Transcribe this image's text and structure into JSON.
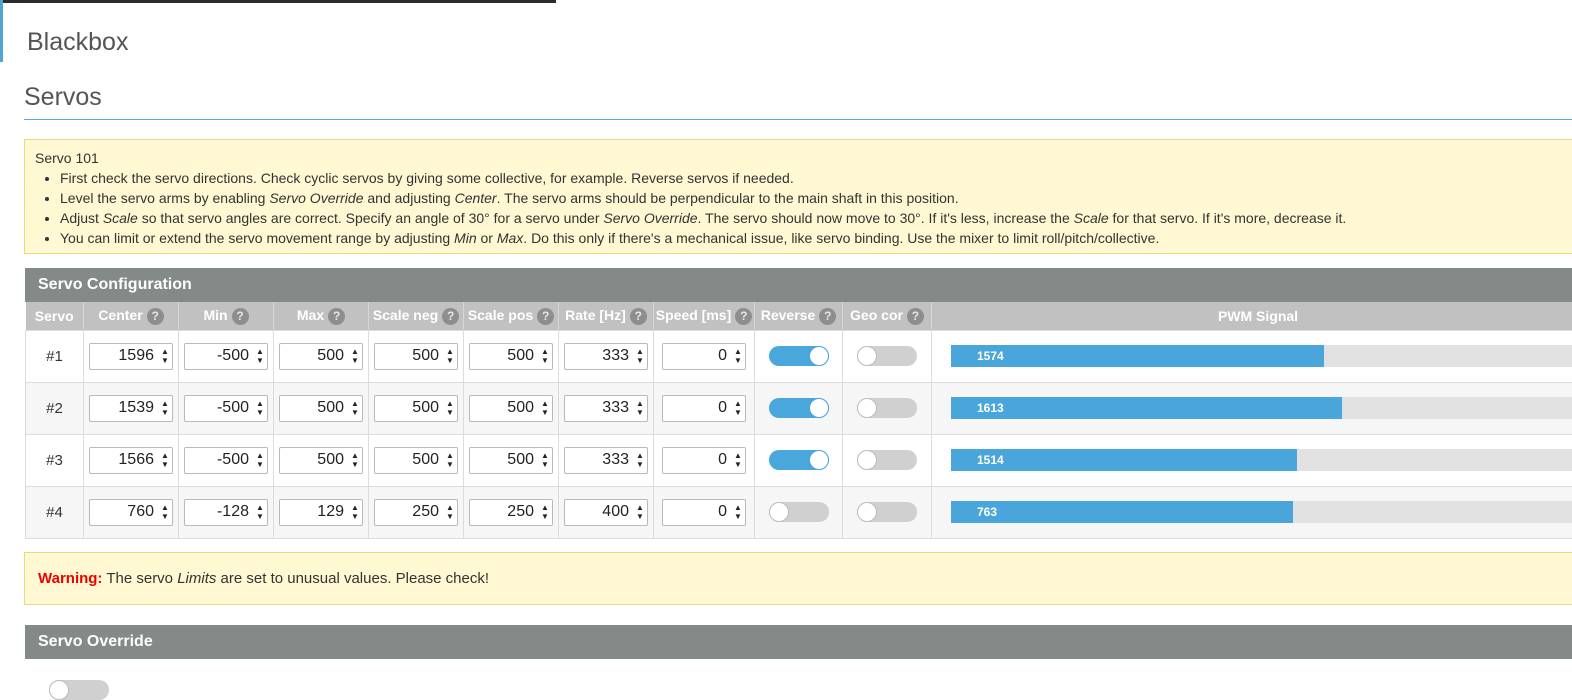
{
  "app": {
    "title": "Blackbox"
  },
  "page": {
    "title": "Servos"
  },
  "note": {
    "title": "Servo 101",
    "items": [
      [
        "First check the servo directions. Check cyclic servos by giving some collective, for example. Reverse servos if needed."
      ],
      [
        "Level the servo arms by enabling ",
        {
          "em": "Servo Override"
        },
        " and adjusting ",
        {
          "em": "Center"
        },
        ". The servo arms should be perpendicular to the main shaft in this position."
      ],
      [
        "Adjust ",
        {
          "em": "Scale"
        },
        " so that servo angles are correct. Specify an angle of 30° for a servo under ",
        {
          "em": "Servo Override"
        },
        ". The servo should now move to 30°. If it's less, increase the ",
        {
          "em": "Scale"
        },
        " for that servo. If it's more, decrease it."
      ],
      [
        "You can limit or extend the servo movement range by adjusting ",
        {
          "em": "Min"
        },
        " or ",
        {
          "em": "Max"
        },
        ". Do this only if there's a mechanical issue, like servo binding. Use the mixer to limit roll/pitch/collective."
      ]
    ]
  },
  "config": {
    "title": "Servo Configuration",
    "columns": [
      {
        "label": "Servo",
        "help": false
      },
      {
        "label": "Center",
        "help": true
      },
      {
        "label": "Min",
        "help": true
      },
      {
        "label": "Max",
        "help": true
      },
      {
        "label": "Scale neg",
        "help": true
      },
      {
        "label": "Scale pos",
        "help": true
      },
      {
        "label": "Rate [Hz]",
        "help": true
      },
      {
        "label": "Speed [ms]",
        "help": true
      },
      {
        "label": "Reverse",
        "help": true
      },
      {
        "label": "Geo cor",
        "help": true
      },
      {
        "label": "PWM Signal",
        "help": false
      }
    ],
    "help_glyph": "?",
    "pwm_range": [
      1000,
      2000
    ],
    "rows": [
      {
        "servo": "#1",
        "center": "1596",
        "min": "-500",
        "max": "500",
        "scale_neg": "500",
        "scale_pos": "500",
        "rate": "333",
        "speed": "0",
        "reverse": true,
        "geo_cor": false,
        "pwm": 1574,
        "pwm_fraction": 0.59
      },
      {
        "servo": "#2",
        "center": "1539",
        "min": "-500",
        "max": "500",
        "scale_neg": "500",
        "scale_pos": "500",
        "rate": "333",
        "speed": "0",
        "reverse": true,
        "geo_cor": false,
        "pwm": 1613,
        "pwm_fraction": 0.617
      },
      {
        "servo": "#3",
        "center": "1566",
        "min": "-500",
        "max": "500",
        "scale_neg": "500",
        "scale_pos": "500",
        "rate": "333",
        "speed": "0",
        "reverse": true,
        "geo_cor": false,
        "pwm": 1514,
        "pwm_fraction": 0.547
      },
      {
        "servo": "#4",
        "center": "760",
        "min": "-128",
        "max": "129",
        "scale_neg": "250",
        "scale_pos": "250",
        "rate": "400",
        "speed": "0",
        "reverse": false,
        "geo_cor": false,
        "pwm": 763,
        "pwm_fraction": 0.54
      }
    ]
  },
  "warning": {
    "label": "Warning:",
    "parts": [
      " The servo ",
      {
        "em": "Limits"
      },
      " are set to unusual values. Please check!"
    ]
  },
  "override": {
    "title": "Servo Override",
    "enabled": false
  },
  "colors": {
    "accent": "#4aa6da",
    "panel_header": "#838a87",
    "warn_bg": "#fff8d2",
    "warn_label": "#ee0000"
  }
}
